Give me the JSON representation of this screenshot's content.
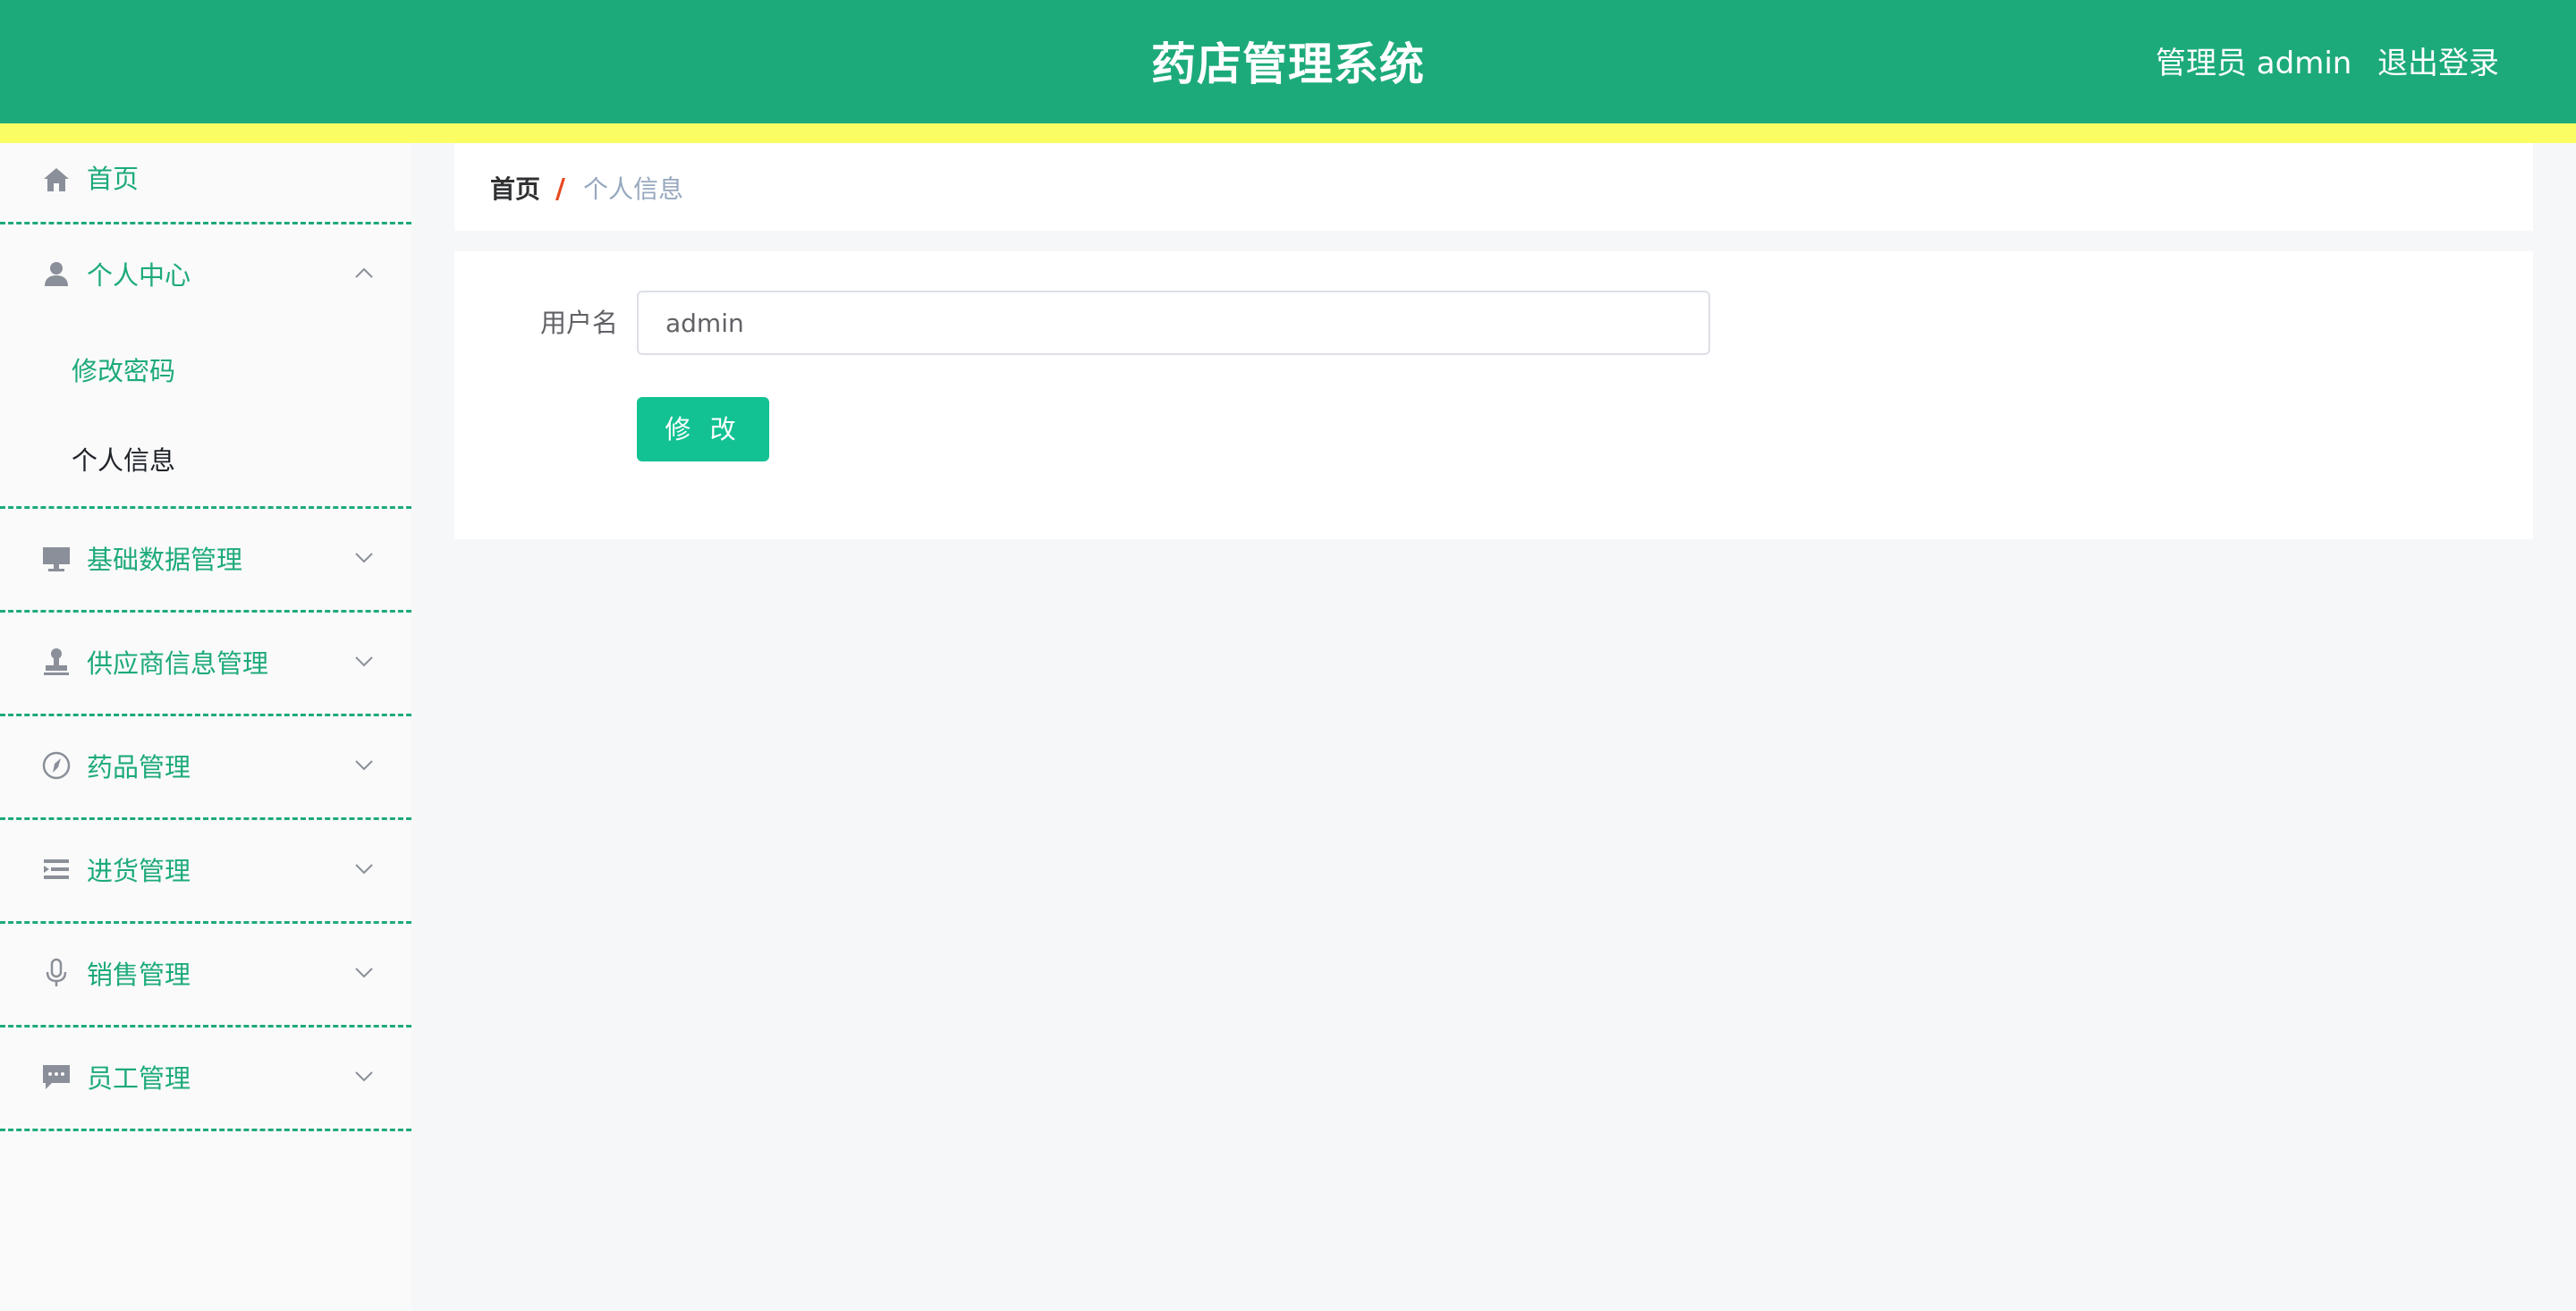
{
  "header": {
    "title": "药店管理系统",
    "user_text": "管理员 admin",
    "logout_label": "退出登录",
    "background_color": "#1daa7a",
    "stripe_color": "#fbfe63"
  },
  "sidebar": {
    "accent_color": "#1daa7a",
    "items": [
      {
        "label": "首页",
        "icon": "home-icon",
        "expandable": false
      },
      {
        "label": "个人中心",
        "icon": "user-icon",
        "expandable": true,
        "expanded": true,
        "children": [
          {
            "label": "修改密码",
            "active": false
          },
          {
            "label": "个人信息",
            "active": true
          }
        ]
      },
      {
        "label": "基础数据管理",
        "icon": "monitor-icon",
        "expandable": true,
        "expanded": false
      },
      {
        "label": "供应商信息管理",
        "icon": "stamp-icon",
        "expandable": true,
        "expanded": false
      },
      {
        "label": "药品管理",
        "icon": "compass-icon",
        "expandable": true,
        "expanded": false
      },
      {
        "label": "进货管理",
        "icon": "list-icon",
        "expandable": true,
        "expanded": false
      },
      {
        "label": "销售管理",
        "icon": "microphone-icon",
        "expandable": true,
        "expanded": false
      },
      {
        "label": "员工管理",
        "icon": "message-icon",
        "expandable": true,
        "expanded": false
      }
    ]
  },
  "breadcrumb": {
    "home": "首页",
    "separator": "/",
    "current": "个人信息"
  },
  "form": {
    "username_label": "用户名",
    "username_value": "admin",
    "submit_label": "修 改",
    "button_color": "#12c293"
  }
}
